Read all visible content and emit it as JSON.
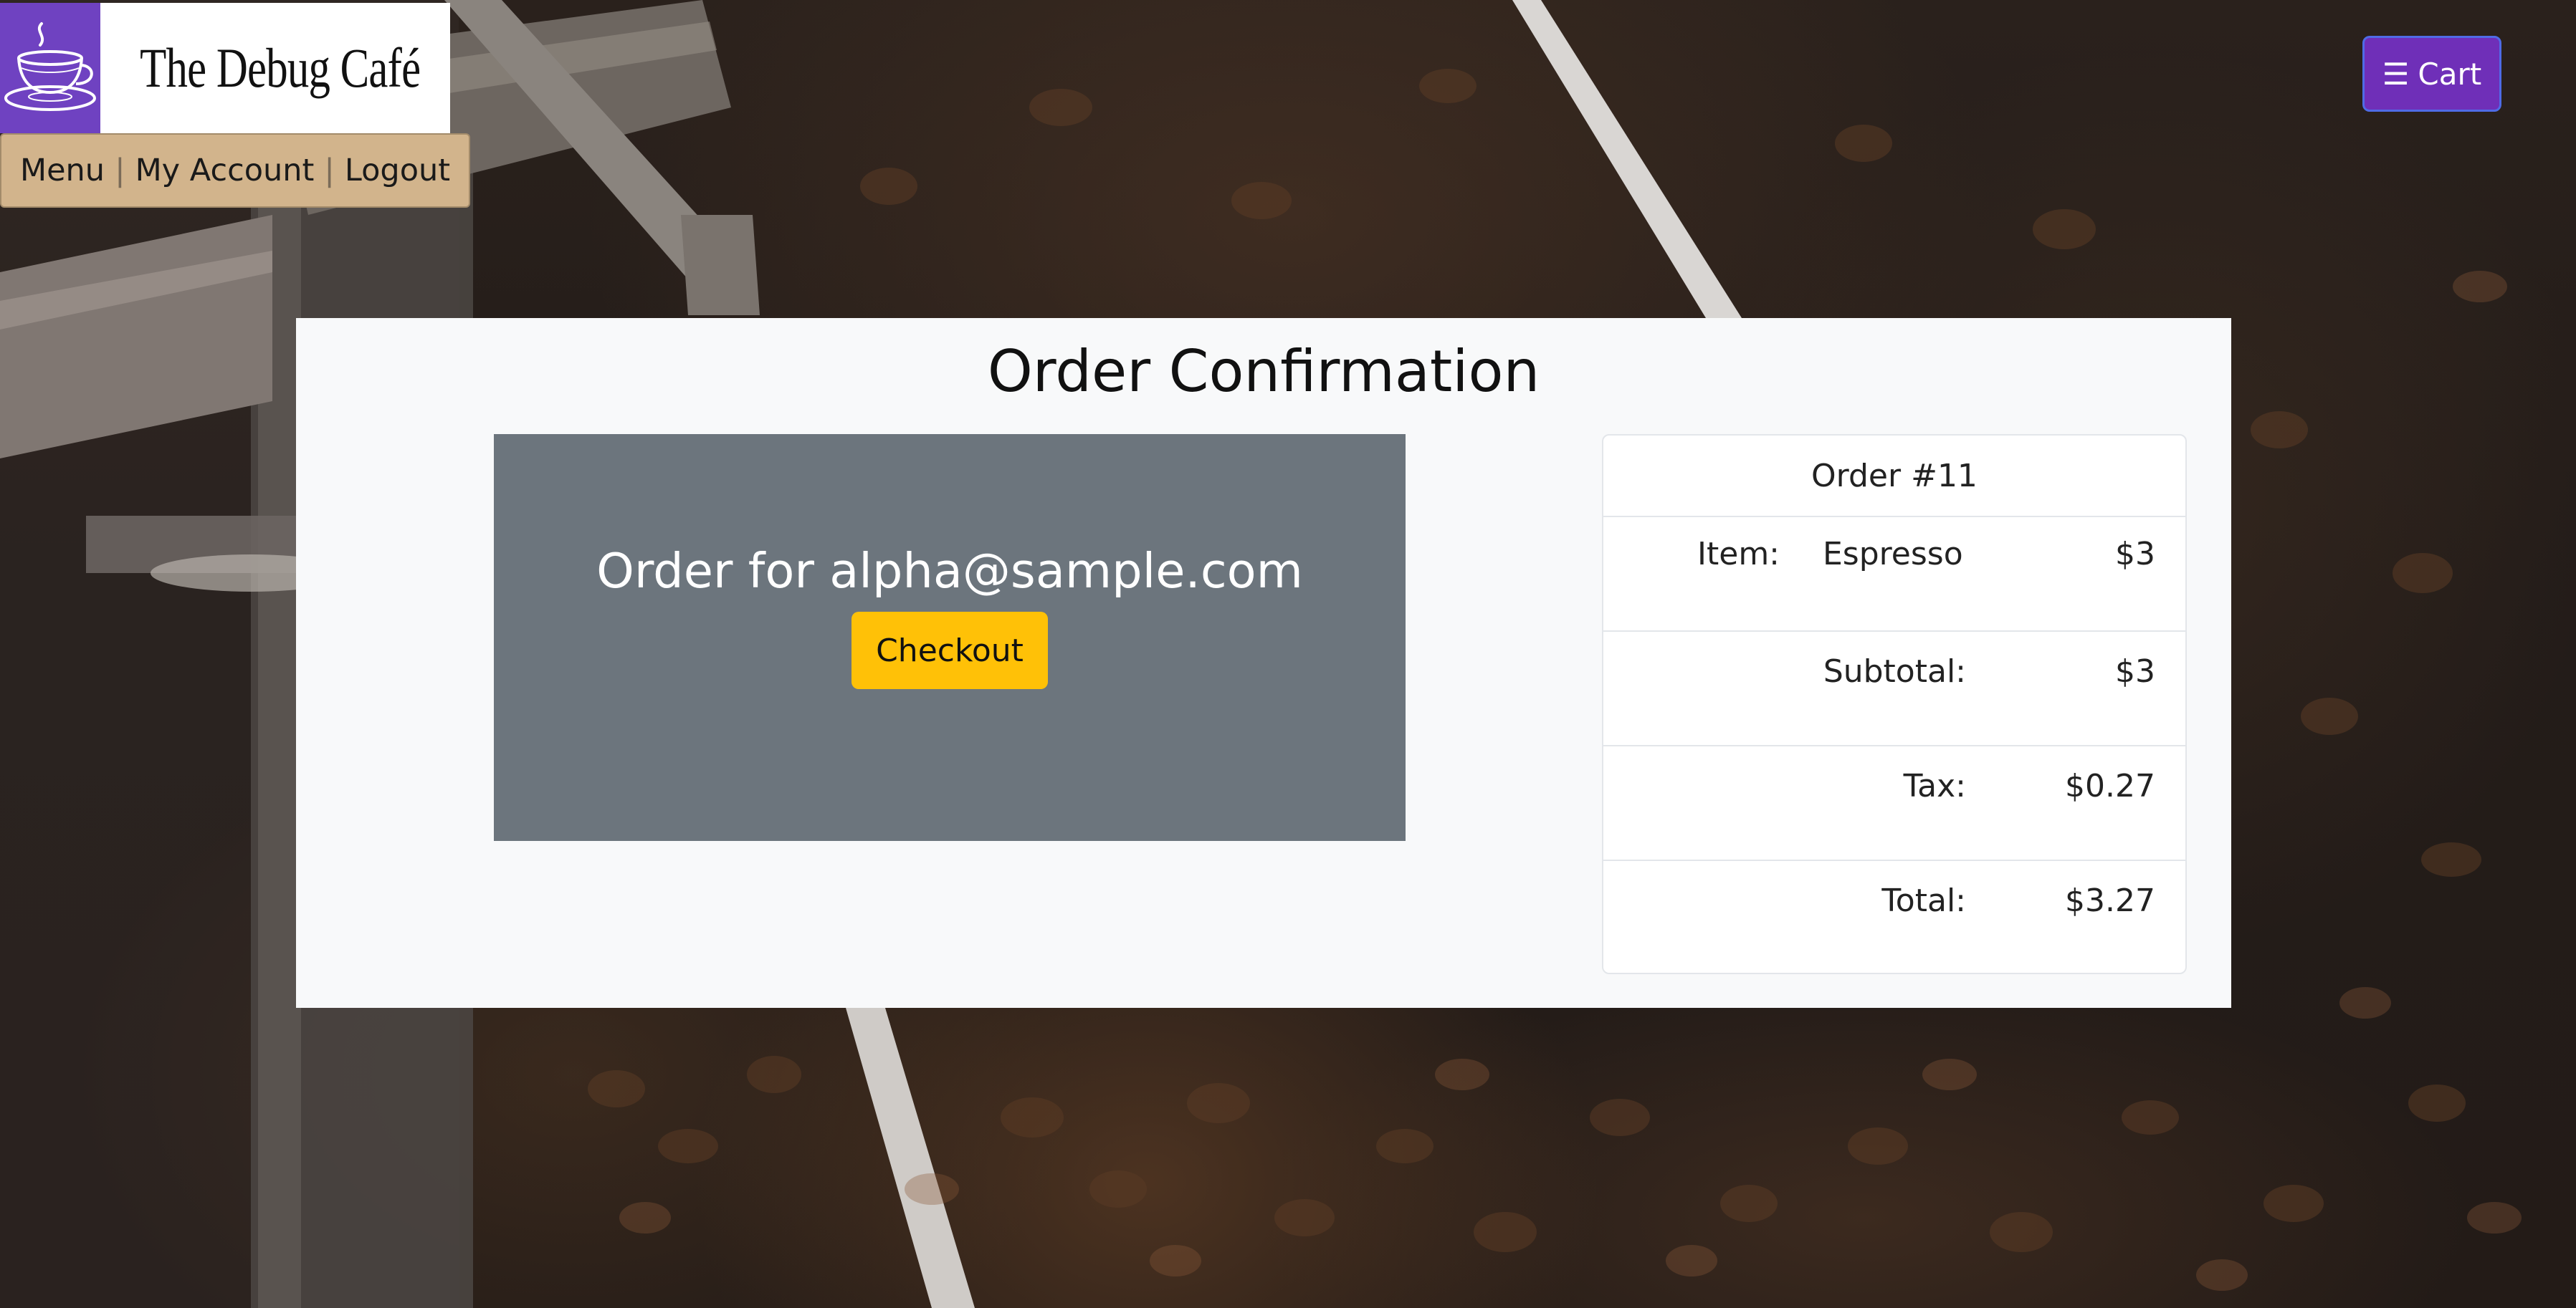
{
  "brand": {
    "name": "The Debug Café",
    "logo_icon": "coffee-cup-icon",
    "logo_bg_color": "#6f42c1"
  },
  "nav": {
    "items": [
      {
        "label": "Menu"
      },
      {
        "label": "My Account"
      },
      {
        "label": "Logout"
      }
    ],
    "separator": "|",
    "bg_color": "#d2b48c"
  },
  "cart": {
    "icon": "hamburger-menu-icon",
    "icon_glyph": "☰",
    "label": "Cart",
    "bg_color": "#6f2fb8"
  },
  "main": {
    "title": "Order Confirmation",
    "order_for": "Order for alpha@sample.com",
    "checkout_label": "Checkout",
    "checkout_color": "#ffc107",
    "order_box_color": "#6c757d"
  },
  "summary": {
    "order_number": "Order #11",
    "item": {
      "label": "Item:",
      "name": "Espresso",
      "price": "$3"
    },
    "subtotal": {
      "label": "Subtotal:",
      "value": "$3"
    },
    "tax": {
      "label": "Tax:",
      "value": "$0.27"
    },
    "total": {
      "label": "Total:",
      "value": "$3.27"
    }
  }
}
